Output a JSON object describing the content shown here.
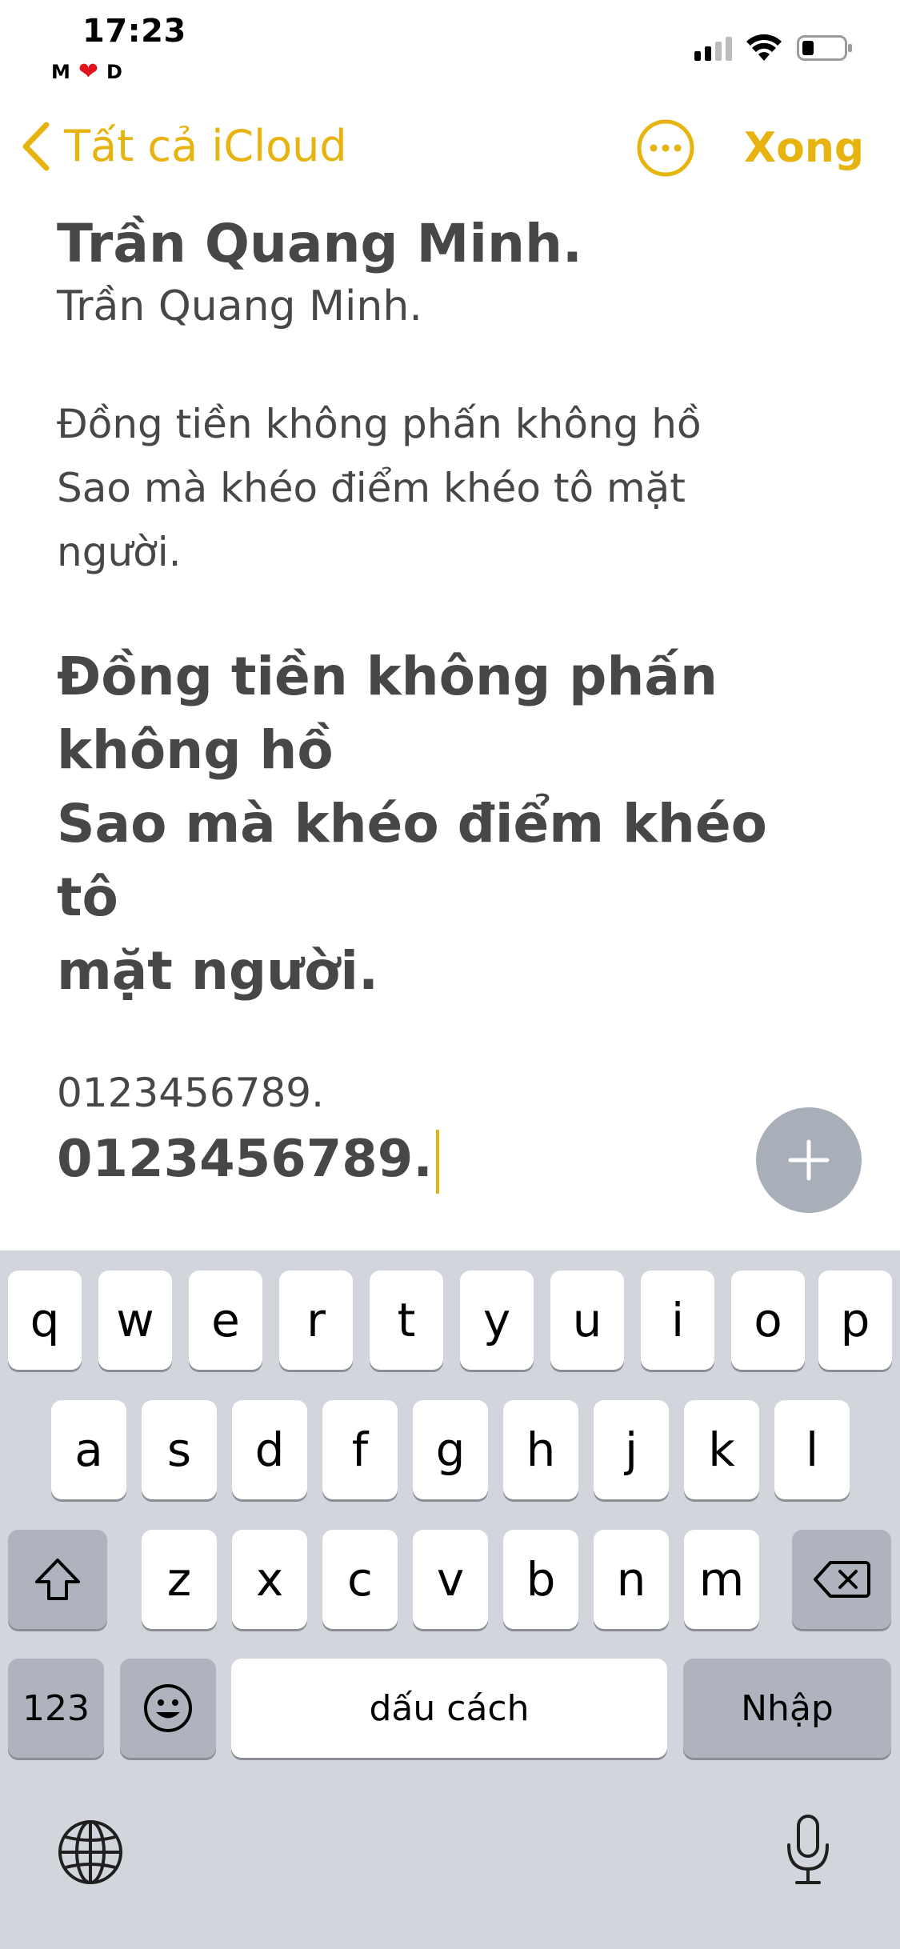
{
  "status_bar": {
    "time": "17:23",
    "carrier_left": "M",
    "carrier_heart": "❤",
    "carrier_right": "D",
    "icons": [
      "signal-icon",
      "wifi-icon",
      "battery-icon"
    ]
  },
  "nav": {
    "back_label": "Tất cả iCloud",
    "more_icon": "ellipsis-circle-icon",
    "done_label": "Xong",
    "accent_color": "#e7b40f"
  },
  "note": {
    "title": "Trần Quang Minh.",
    "subtitle": "Trần Quang Minh.",
    "body_lines": [
      "Đồng tiền không phấn không hồ",
      "Sao mà khéo điểm khéo tô mặt",
      "người."
    ],
    "heading_lines": [
      "Đồng tiền không phấn",
      "không hồ",
      "Sao mà khéo điểm khéo tô",
      "mặt người."
    ],
    "number_line": "0123456789.",
    "number_bold": "0123456789."
  },
  "fab": {
    "icon": "plus-icon"
  },
  "keyboard": {
    "row1": [
      "q",
      "w",
      "e",
      "r",
      "t",
      "y",
      "u",
      "i",
      "o",
      "p"
    ],
    "row2": [
      "a",
      "s",
      "d",
      "f",
      "g",
      "h",
      "j",
      "k",
      "l"
    ],
    "row3": [
      "z",
      "x",
      "c",
      "v",
      "b",
      "n",
      "m"
    ],
    "shift_icon": "shift-icon",
    "delete_icon": "delete-icon",
    "numbers_label": "123",
    "emoji_icon": "emoji-icon",
    "space_label": "dấu cách",
    "return_label": "Nhập",
    "globe_icon": "globe-icon",
    "mic_icon": "microphone-icon"
  }
}
